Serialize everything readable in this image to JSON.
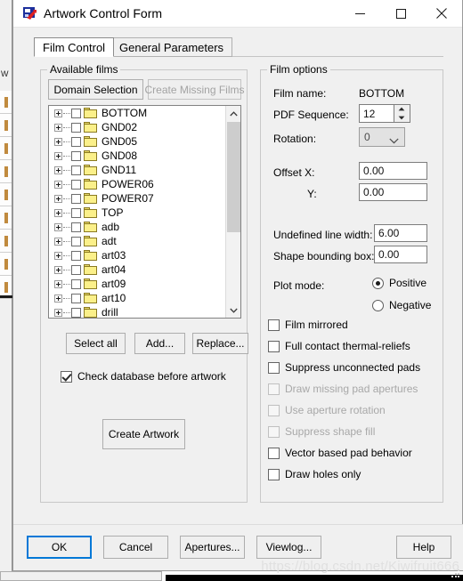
{
  "window": {
    "title": "Artwork Control Form",
    "icon": "app-icon",
    "controls": {
      "minimize": "minimize-icon",
      "maximize": "maximize-icon",
      "close": "close-icon"
    }
  },
  "tabs": [
    {
      "label": "Film Control",
      "active": true
    },
    {
      "label": "General Parameters",
      "active": false
    }
  ],
  "available_films": {
    "group_label": "Available films",
    "domain_selection_label": "Domain Selection",
    "create_missing_films_label": "Create Missing Films",
    "create_missing_films_enabled": false,
    "items": [
      {
        "label": "BOTTOM",
        "checked": false,
        "expandable": true
      },
      {
        "label": "GND02",
        "checked": false,
        "expandable": true
      },
      {
        "label": "GND05",
        "checked": false,
        "expandable": true
      },
      {
        "label": "GND08",
        "checked": false,
        "expandable": true
      },
      {
        "label": "GND11",
        "checked": false,
        "expandable": true
      },
      {
        "label": "POWER06",
        "checked": false,
        "expandable": true
      },
      {
        "label": "POWER07",
        "checked": false,
        "expandable": true
      },
      {
        "label": "TOP",
        "checked": false,
        "expandable": true
      },
      {
        "label": "adb",
        "checked": false,
        "expandable": true
      },
      {
        "label": "adt",
        "checked": false,
        "expandable": true
      },
      {
        "label": "art03",
        "checked": false,
        "expandable": true
      },
      {
        "label": "art04",
        "checked": false,
        "expandable": true
      },
      {
        "label": "art09",
        "checked": false,
        "expandable": true
      },
      {
        "label": "art10",
        "checked": false,
        "expandable": true
      },
      {
        "label": "drill",
        "checked": false,
        "expandable": true
      }
    ],
    "select_all_label": "Select all",
    "add_label": "Add...",
    "replace_label": "Replace...",
    "check_database_label": "Check database before artwork",
    "check_database_checked": true,
    "create_artwork_label": "Create Artwork"
  },
  "film_options": {
    "group_label": "Film options",
    "film_name_label": "Film name:",
    "film_name_value": "BOTTOM",
    "pdf_sequence_label": "PDF Sequence:",
    "pdf_sequence_value": "12",
    "rotation_label": "Rotation:",
    "rotation_value": "0",
    "offset_x_label": "Offset  X:",
    "offset_x_value": "0.00",
    "offset_y_label": "Y:",
    "offset_y_value": "0.00",
    "undefined_line_width_label": "Undefined line width:",
    "undefined_line_width_value": "6.00",
    "shape_bounding_box_label": "Shape bounding box:",
    "shape_bounding_box_value": "0.00",
    "plot_mode_label": "Plot mode:",
    "plot_mode_options": [
      {
        "label": "Positive",
        "selected": true
      },
      {
        "label": "Negative",
        "selected": false
      }
    ],
    "checkboxes": [
      {
        "label": "Film mirrored",
        "checked": false,
        "enabled": true
      },
      {
        "label": "Full contact thermal-reliefs",
        "checked": false,
        "enabled": true
      },
      {
        "label": "Suppress unconnected pads",
        "checked": false,
        "enabled": true
      },
      {
        "label": "Draw missing pad apertures",
        "checked": false,
        "enabled": false
      },
      {
        "label": "Use aperture rotation",
        "checked": false,
        "enabled": false
      },
      {
        "label": "Suppress shape fill",
        "checked": false,
        "enabled": false
      },
      {
        "label": "Vector based pad behavior",
        "checked": false,
        "enabled": true
      },
      {
        "label": "Draw holes only",
        "checked": false,
        "enabled": true
      }
    ]
  },
  "bottom_buttons": [
    {
      "label": "OK",
      "name": "ok-button",
      "default": true
    },
    {
      "label": "Cancel",
      "name": "cancel-button",
      "default": false
    },
    {
      "label": "Apertures...",
      "name": "apertures-button",
      "default": false
    },
    {
      "label": "Viewlog...",
      "name": "viewlog-button",
      "default": false
    },
    {
      "label": "Help",
      "name": "help-button",
      "default": false
    }
  ],
  "watermark": "https://blog.csdn.net/Kiwifruit666",
  "background": {
    "left_panel_label": "W"
  },
  "colors": {
    "accent": "#0078d7",
    "dialog_bg": "#f0f0f0",
    "folder": "#fbf08a",
    "pcb_trace": "#b11414"
  }
}
